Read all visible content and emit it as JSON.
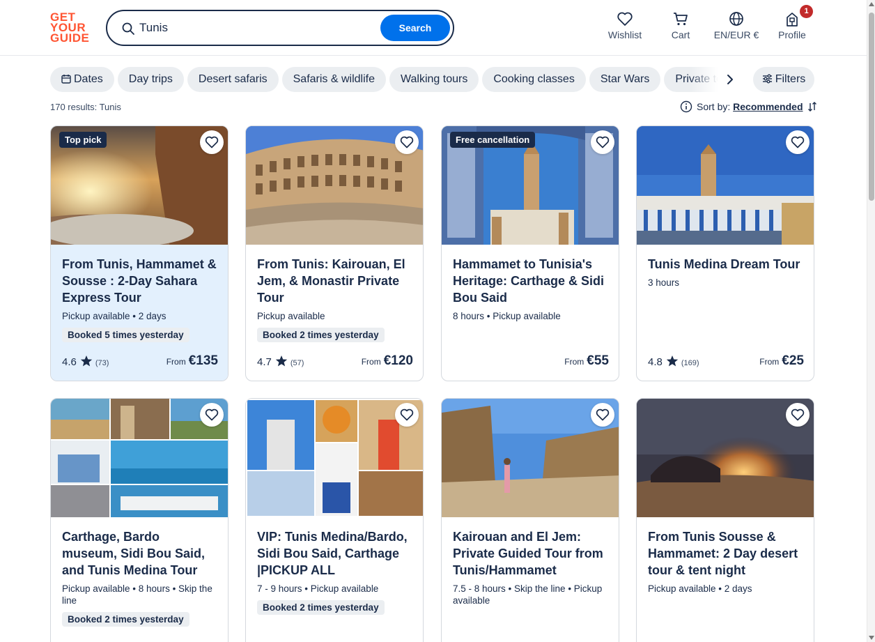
{
  "logo": {
    "line1": "GET",
    "line2": "YOUR",
    "line3": "GUIDE"
  },
  "search": {
    "value": "Tunis",
    "button": "Search"
  },
  "nav": {
    "wishlist": "Wishlist",
    "cart": "Cart",
    "language": "EN/EUR €",
    "profile": "Profile",
    "profile_badge": "1"
  },
  "chips": [
    "Dates",
    "Day trips",
    "Desert safaris",
    "Safaris & wildlife",
    "Walking tours",
    "Cooking classes",
    "Star Wars",
    "Private tours"
  ],
  "filters_label": "Filters",
  "results_text": "170 results: Tunis",
  "sort": {
    "label": "Sort by:",
    "value": "Recommended"
  },
  "colors": {
    "brand": "#ff5533",
    "accent": "#0071eb",
    "text": "#1a2b49",
    "highlight": "#e3f0fd",
    "badge": "#c22a2a"
  },
  "cards": [
    {
      "tag": "Top pick",
      "title": "From Tunis, Hammamet & Sousse : 2-Day Sahara Express Tour",
      "meta": "Pickup available • 2 days",
      "booked": "Booked 5 times yesterday",
      "rating": "4.6",
      "reviews": "(73)",
      "from": "From",
      "price": "€135"
    },
    {
      "tag": "",
      "title": "From Tunis: Kairouan, El Jem, & Monastir Private Tour",
      "meta": "Pickup available",
      "booked": "Booked 2 times yesterday",
      "rating": "4.7",
      "reviews": "(57)",
      "from": "From",
      "price": "€120"
    },
    {
      "tag": "Free cancellation",
      "title": "Hammamet to Tunisia's Heritage: Carthage & Sidi Bou Said",
      "meta": "8 hours • Pickup available",
      "booked": "",
      "rating": "",
      "reviews": "",
      "from": "From",
      "price": "€55"
    },
    {
      "tag": "",
      "title": "Tunis Medina Dream Tour",
      "meta": "3 hours",
      "booked": "",
      "rating": "4.8",
      "reviews": "(169)",
      "from": "From",
      "price": "€25"
    },
    {
      "tag": "",
      "title": "Carthage, Bardo museum, Sidi Bou Said, and Tunis Medina Tour",
      "meta": "Pickup available • 8 hours • Skip the line",
      "booked": "Booked 2 times yesterday",
      "rating": "",
      "reviews": "",
      "from": "",
      "price": ""
    },
    {
      "tag": "",
      "title": "VIP: Tunis Medina/Bardo, Sidi Bou Said, Carthage |PICKUP ALL",
      "meta": "7 - 9 hours • Pickup available",
      "booked": "Booked 2 times yesterday",
      "rating": "",
      "reviews": "",
      "from": "",
      "price": ""
    },
    {
      "tag": "",
      "title": "Kairouan and El Jem: Private Guided Tour from Tunis/Hammamet",
      "meta": "7.5 - 8 hours • Skip the line • Pickup available",
      "booked": "",
      "rating": "",
      "reviews": "",
      "from": "",
      "price": ""
    },
    {
      "tag": "",
      "title": "From Tunis Sousse & Hammamet: 2 Day desert tour & tent night",
      "meta": "Pickup available • 2 days",
      "booked": "",
      "rating": "",
      "reviews": "",
      "from": "",
      "price": ""
    }
  ]
}
